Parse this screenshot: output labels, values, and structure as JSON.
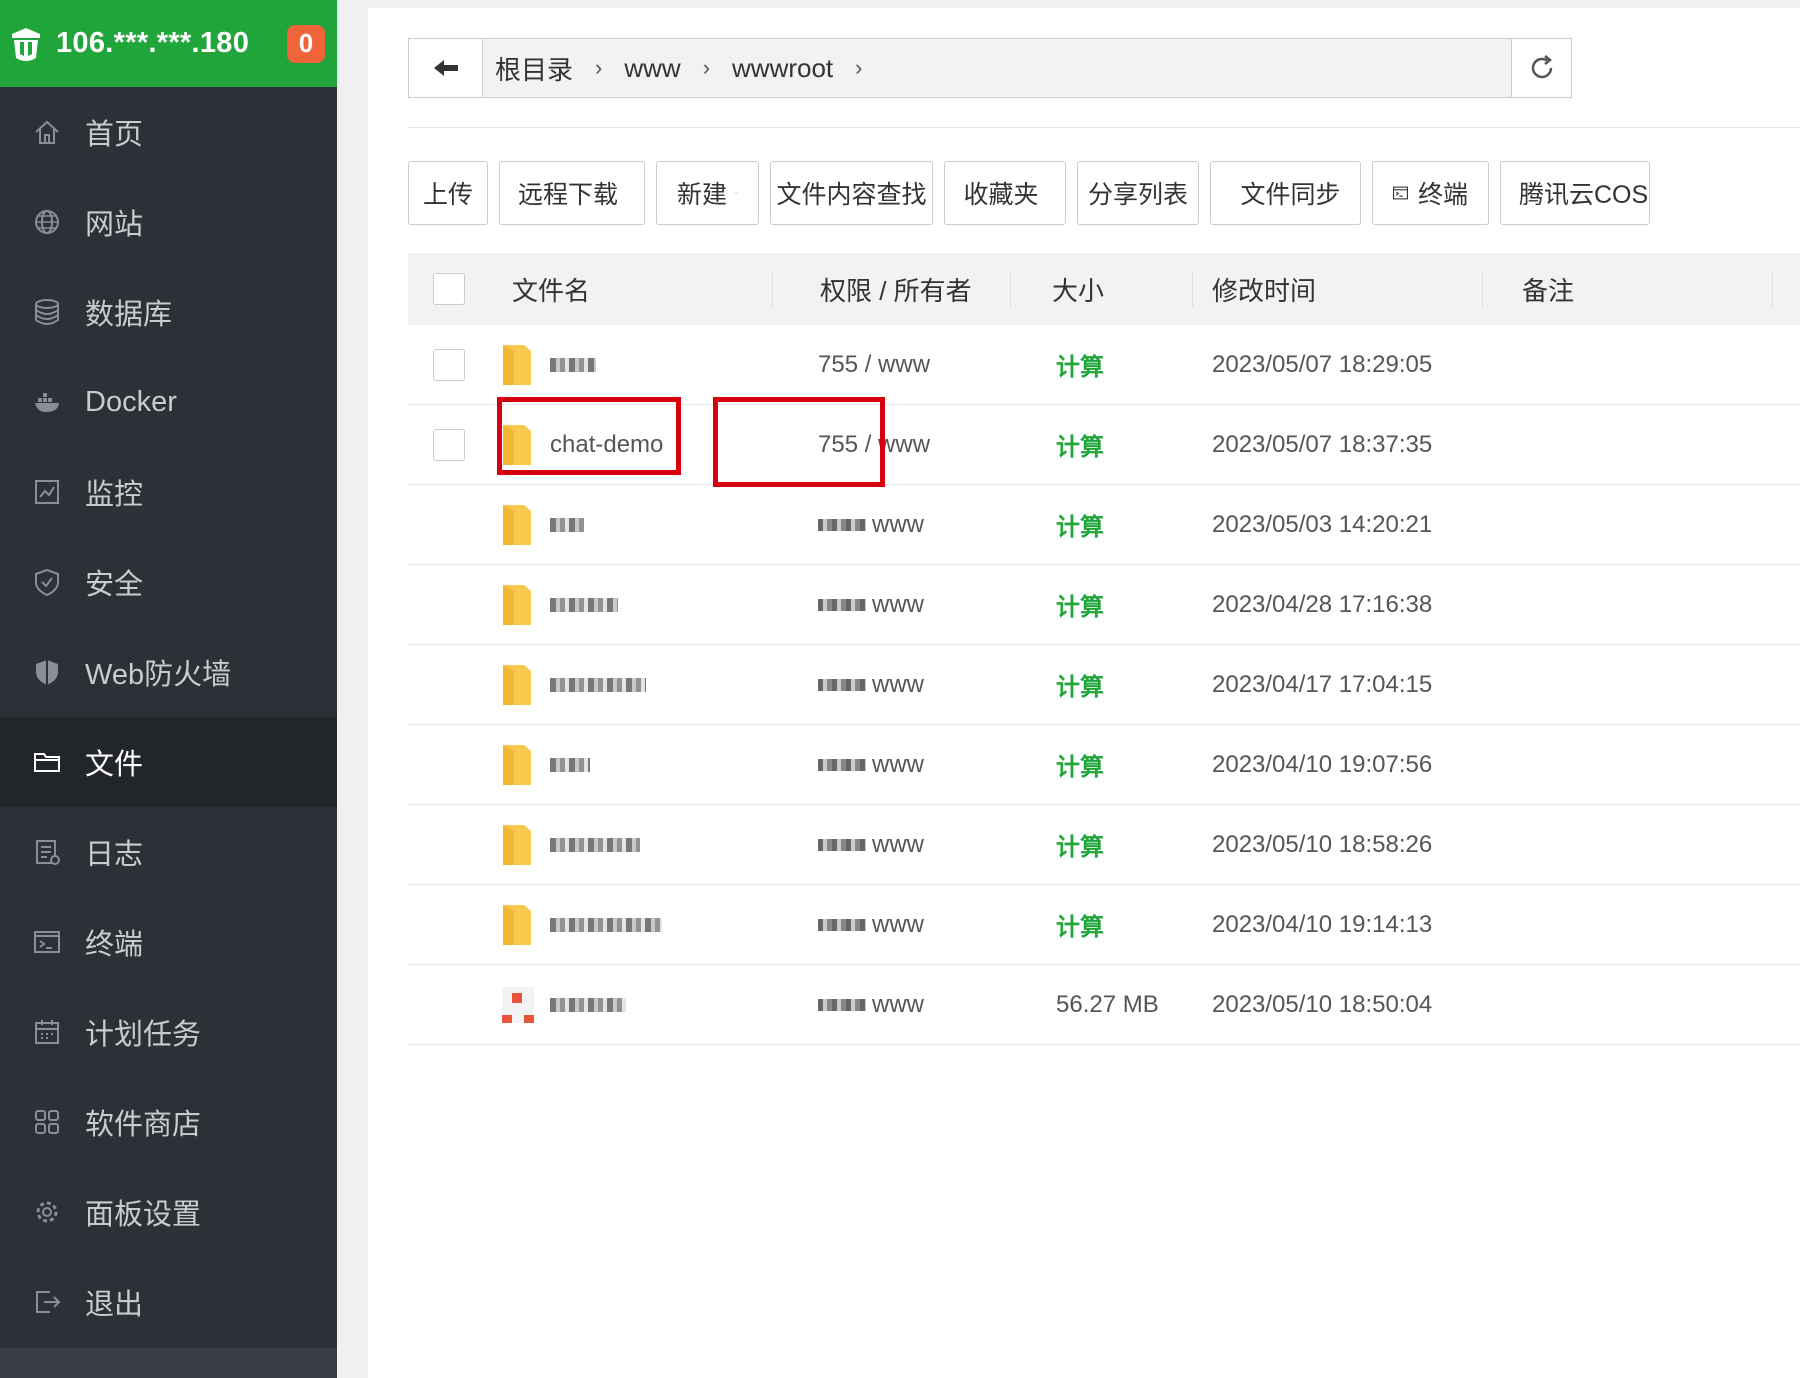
{
  "header": {
    "ip": "106.***.***.180",
    "badge": "0"
  },
  "sidebar": {
    "items": [
      {
        "label": "首页",
        "icon": "home-icon"
      },
      {
        "label": "网站",
        "icon": "globe-icon"
      },
      {
        "label": "数据库",
        "icon": "database-icon"
      },
      {
        "label": "Docker",
        "icon": "docker-icon"
      },
      {
        "label": "监控",
        "icon": "monitor-icon"
      },
      {
        "label": "安全",
        "icon": "shield-icon"
      },
      {
        "label": "Web防火墙",
        "icon": "firewall-icon"
      },
      {
        "label": "文件",
        "icon": "folder-icon",
        "active": true
      },
      {
        "label": "日志",
        "icon": "log-icon"
      },
      {
        "label": "终端",
        "icon": "terminal-icon"
      },
      {
        "label": "计划任务",
        "icon": "calendar-icon"
      },
      {
        "label": "软件商店",
        "icon": "apps-icon"
      },
      {
        "label": "面板设置",
        "icon": "gear-icon"
      },
      {
        "label": "退出",
        "icon": "logout-icon"
      }
    ]
  },
  "path": {
    "crumbs": [
      "根目录",
      "www",
      "wwwroot"
    ]
  },
  "toolbar": {
    "upload": "上传",
    "remote_download": "远程下载",
    "new": "新建",
    "search_content": "文件内容查找",
    "favorites": "收藏夹",
    "share_list": "分享列表",
    "file_sync": "文件同步",
    "terminal": "终端",
    "cos": "腾讯云COS"
  },
  "table": {
    "headers": {
      "name": "文件名",
      "perm": "权限 / 所有者",
      "size": "大小",
      "mtime": "修改时间",
      "note": "备注"
    },
    "rows": [
      {
        "name": "",
        "perm": "755 / www",
        "size": "计算",
        "mtime": "2023/05/07 18:29:05"
      },
      {
        "name": "chat-demo",
        "perm": "755 / www",
        "size": "计算",
        "mtime": "2023/05/07 18:37:35"
      },
      {
        "name": "",
        "perm": "www",
        "size": "计算",
        "mtime": "2023/05/03 14:20:21"
      },
      {
        "name": "",
        "perm": "www",
        "size": "计算",
        "mtime": "2023/04/28 17:16:38"
      },
      {
        "name": "",
        "perm": "www",
        "size": "计算",
        "mtime": "2023/04/17 17:04:15"
      },
      {
        "name": "",
        "perm": "www",
        "size": "计算",
        "mtime": "2023/04/10 19:07:56"
      },
      {
        "name": "",
        "perm": "www",
        "size": "计算",
        "mtime": "2023/05/10 18:58:26"
      },
      {
        "name": "",
        "perm": "www",
        "size": "计算",
        "mtime": "2023/04/10 19:14:13"
      },
      {
        "name": "",
        "perm": "www",
        "size": "56.27 MB",
        "mtime": "2023/05/10 18:50:04"
      }
    ]
  },
  "colors": {
    "brand": "#20a53a",
    "sidebar": "#2d3036",
    "badge": "#f0643a",
    "highlight": "#d7000f"
  }
}
